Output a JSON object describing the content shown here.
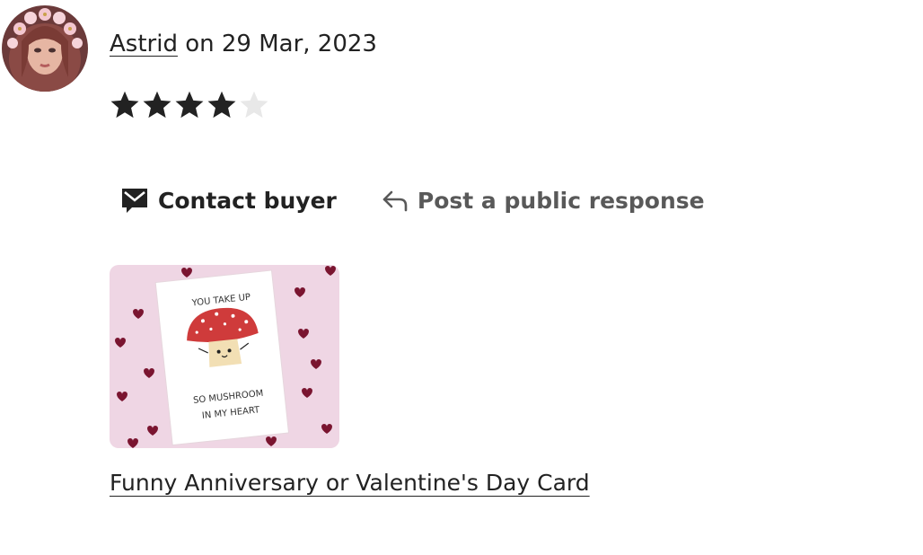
{
  "review": {
    "reviewer_name": "Astrid",
    "date_text": " on 29 Mar, 2023",
    "rating": 4,
    "rating_max": 5
  },
  "actions": {
    "contact_label": "Contact buyer",
    "respond_label": "Post a public response"
  },
  "listing": {
    "title": "Funny Anniversary or Valentine's Day Card",
    "image_text": {
      "top": "YOU TAKE UP",
      "middle": "SO MUSHROOM",
      "bottom": "IN MY HEART"
    }
  },
  "colors": {
    "star_filled": "#222222",
    "star_empty": "#e8e8e8",
    "link_text": "#222222",
    "muted_text": "#595959",
    "thumbnail_background": "#efd6e4",
    "mushroom_cap": "#cf3b3b"
  },
  "icons": {
    "contact": "mail-icon",
    "respond": "reply-arrow-icon",
    "star": "star-icon"
  }
}
